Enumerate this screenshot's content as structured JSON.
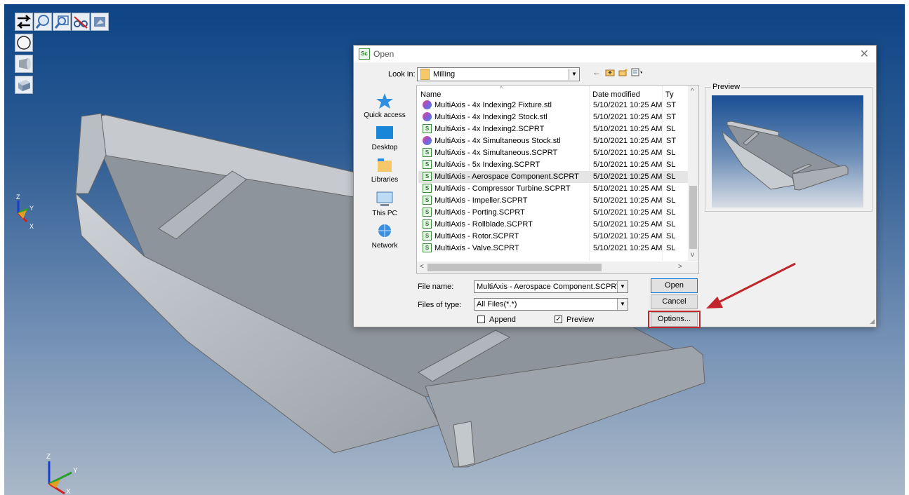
{
  "dialog": {
    "title": "Open",
    "app_badge": "Sc",
    "close_glyph": "✕",
    "look_in_label": "Look in:",
    "look_in_value": "Milling",
    "places": [
      {
        "label": "Quick access",
        "icon": "star-icon"
      },
      {
        "label": "Desktop",
        "icon": "desktop-icon"
      },
      {
        "label": "Libraries",
        "icon": "libraries-icon"
      },
      {
        "label": "This PC",
        "icon": "computer-icon"
      },
      {
        "label": "Network",
        "icon": "network-icon"
      }
    ],
    "columns": {
      "name": "Name",
      "date": "Date modified",
      "type": "Ty"
    },
    "files": [
      {
        "name": "MultiAxis - 4x Indexing2 Fixture.stl",
        "date": "5/10/2021 10:25 AM",
        "type": "ST",
        "kind": "stl"
      },
      {
        "name": "MultiAxis - 4x Indexing2 Stock.stl",
        "date": "5/10/2021 10:25 AM",
        "type": "ST",
        "kind": "stl"
      },
      {
        "name": "MultiAxis - 4x Indexing2.SCPRT",
        "date": "5/10/2021 10:25 AM",
        "type": "SL",
        "kind": "scprt"
      },
      {
        "name": "MultiAxis - 4x Simultaneous Stock.stl",
        "date": "5/10/2021 10:25 AM",
        "type": "ST",
        "kind": "stl"
      },
      {
        "name": "MultiAxis - 4x Simultaneous.SCPRT",
        "date": "5/10/2021 10:25 AM",
        "type": "SL",
        "kind": "scprt"
      },
      {
        "name": "MultiAxis - 5x Indexing.SCPRT",
        "date": "5/10/2021 10:25 AM",
        "type": "SL",
        "kind": "scprt"
      },
      {
        "name": "MultiAxis - Aerospace Component.SCPRT",
        "date": "5/10/2021 10:25 AM",
        "type": "SL",
        "kind": "scprt",
        "selected": true
      },
      {
        "name": "MultiAxis - Compressor Turbine.SCPRT",
        "date": "5/10/2021 10:25 AM",
        "type": "SL",
        "kind": "scprt"
      },
      {
        "name": "MultiAxis - Impeller.SCPRT",
        "date": "5/10/2021 10:25 AM",
        "type": "SL",
        "kind": "scprt"
      },
      {
        "name": "MultiAxis - Porting.SCPRT",
        "date": "5/10/2021 10:25 AM",
        "type": "SL",
        "kind": "scprt"
      },
      {
        "name": "MultiAxis - Rollblade.SCPRT",
        "date": "5/10/2021 10:25 AM",
        "type": "SL",
        "kind": "scprt"
      },
      {
        "name": "MultiAxis - Rotor.SCPRT",
        "date": "5/10/2021 10:25 AM",
        "type": "SL",
        "kind": "scprt"
      },
      {
        "name": "MultiAxis - Valve.SCPRT",
        "date": "5/10/2021 10:25 AM",
        "type": "SL",
        "kind": "scprt"
      }
    ],
    "preview_label": "Preview",
    "file_name_label": "File name:",
    "file_name_value": "MultiAxis - Aerospace Component.SCPRT",
    "files_of_type_label": "Files of type:",
    "files_of_type_value": "All Files(*.*)",
    "append_label": "Append",
    "append_checked": false,
    "preview_checkbox_label": "Preview",
    "preview_checked": true,
    "open_button": "Open",
    "cancel_button": "Cancel",
    "options_button": "Options..."
  },
  "viewport": {
    "toolbar_icons": [
      "pan-arrows-icon",
      "zoom-icon",
      "zoom-window-icon",
      "glasses-icon",
      "view-icon",
      "sphere-icon",
      "cone-icon",
      "box-icon"
    ],
    "triad_labels": {
      "z": "Z",
      "y": "Y",
      "x": "X"
    }
  },
  "colors": {
    "highlight": "#c0262b",
    "selection": "#e5e5e5",
    "viewport_top": "#0d4485",
    "viewport_bottom": "#aab8c8"
  }
}
